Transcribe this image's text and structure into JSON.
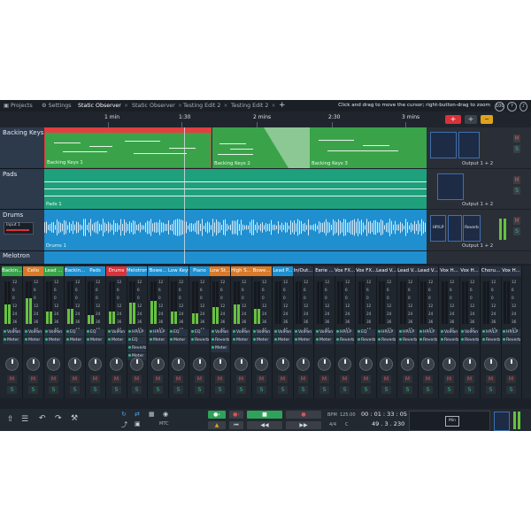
{
  "tabs": [
    {
      "label": "Projects",
      "icon": "folder-icon"
    },
    {
      "label": "Settings",
      "icon": "gear-icon"
    },
    {
      "label": "Static Observer",
      "active": true
    },
    {
      "label": "Static Observer"
    },
    {
      "label": "Testing Edit 2"
    },
    {
      "label": "Testing Edit 2"
    }
  ],
  "hint_text": "Click and drag to move the cursor; right-button-drag to zoom",
  "zoom_value": "100",
  "help_label": "?",
  "ruler": {
    "ticks": [
      "1 min",
      "1:30",
      "2 mins",
      "2:30",
      "3 mins"
    ]
  },
  "toolbar": {
    "add_track_label": "+",
    "add_label": "+",
    "wave_label": "~"
  },
  "tracks": [
    {
      "name": "Backing Keys",
      "clips": [
        "Backing Keys 1",
        "Backing Keys 2",
        "Backing Keys 3"
      ],
      "output": "Output 1 + 2",
      "color": "#3aa34a"
    },
    {
      "name": "Pads",
      "clips": [
        "Pads 1"
      ],
      "output": "Output 1 + 2",
      "color": "#1fa07c"
    },
    {
      "name": "Drums",
      "clips": [
        "Drums 1"
      ],
      "output": "Output 1 + 2",
      "input_label": "Input 1",
      "plugins": [
        "HP/LP",
        "Reverb"
      ],
      "color": "#1f8fd0"
    },
    {
      "name": "Melotron"
    }
  ],
  "mixer": {
    "strips": [
      {
        "name": "Backin...",
        "color": "#3aa34a",
        "plugins": [
          "VolPan",
          "Meter"
        ],
        "level": 0.45
      },
      {
        "name": "Cello",
        "color": "#d87a2a",
        "plugins": [
          "VolPan",
          "Meter"
        ],
        "level": 0.6
      },
      {
        "name": "Lead ...",
        "color": "#3aa34a",
        "plugins": [
          "VolPan",
          "Meter"
        ],
        "level": 0.3
      },
      {
        "name": "Backin...",
        "color": "#1f8fd0",
        "plugins": [
          "EQ",
          "Meter"
        ],
        "level": 0.35
      },
      {
        "name": "Pads",
        "color": "#1f8fd0",
        "plugins": [
          "EQ",
          "Meter"
        ],
        "level": 0.2
      },
      {
        "name": "Drums",
        "color": "#d8323a",
        "plugins": [
          "VolPan",
          "Meter"
        ],
        "level": 0.3
      },
      {
        "name": "Melotron",
        "color": "#1f8fd0",
        "plugins": [
          "HP/LP",
          "EQ",
          "Reverb",
          "Meter"
        ],
        "level": 0.5
      },
      {
        "name": "Bowe...",
        "color": "#1f8fd0",
        "plugins": [
          "HP/LP",
          "Meter"
        ],
        "level": 0.55
      },
      {
        "name": "Low Keys",
        "color": "#1f8fd0",
        "plugins": [
          "EQ",
          "Meter"
        ],
        "level": 0.3
      },
      {
        "name": "Piano",
        "color": "#1f8fd0",
        "plugins": [
          "EQ",
          "Reverb"
        ],
        "level": 0.25
      },
      {
        "name": "Low St...",
        "color": "#d87a2a",
        "plugins": [
          "VolPan",
          "Reverb",
          "Meter"
        ],
        "level": 0.4
      },
      {
        "name": "High S...",
        "color": "#d87a2a",
        "plugins": [
          "VolPan",
          "Meter"
        ],
        "level": 0.45
      },
      {
        "name": "Bowe...",
        "color": "#d87a2a",
        "plugins": [
          "VolPan",
          "Meter"
        ],
        "level": 0.35
      },
      {
        "name": "Lead P...",
        "color": "#1f8fd0",
        "plugins": [
          "VolPan",
          "Meter"
        ],
        "level": 0.0
      },
      {
        "name": "In/Out...",
        "color": "#2a3140",
        "plugins": [
          "VolPan",
          "Meter"
        ],
        "level": 0.0
      },
      {
        "name": "Eerie ...",
        "color": "#2a3140",
        "plugins": [
          "VolPan",
          "Meter"
        ],
        "level": 0.0
      },
      {
        "name": "Vox FX...",
        "color": "#2a3140",
        "plugins": [
          "HP/LP",
          "Reverb"
        ],
        "level": 0.0
      },
      {
        "name": "Vox FX...",
        "color": "#2a3140",
        "plugins": [
          "EQ",
          "Reverb"
        ],
        "level": 0.0
      },
      {
        "name": "Lead V...",
        "color": "#2a3140",
        "plugins": [
          "HP/LP",
          "Reverb"
        ],
        "level": 0.0
      },
      {
        "name": "Lead V...",
        "color": "#2a3140",
        "plugins": [
          "HP/LP",
          "Reverb"
        ],
        "level": 0.0
      },
      {
        "name": "Lead V...",
        "color": "#2a3140",
        "plugins": [
          "HP/LP",
          "Reverb"
        ],
        "level": 0.0
      },
      {
        "name": "Vox H...",
        "color": "#2a3140",
        "plugins": [
          "VolPan",
          "Reverb"
        ],
        "level": 0.0
      },
      {
        "name": "Vox H...",
        "color": "#2a3140",
        "plugins": [
          "VolPan",
          "Reverb"
        ],
        "level": 0.0
      },
      {
        "name": "Choru...",
        "color": "#2a3140",
        "plugins": [
          "HP/LP",
          "Reverb"
        ],
        "level": 0.0
      },
      {
        "name": "Vox H...",
        "color": "#2a3140",
        "plugins": [
          "HP/LP",
          "Reverb"
        ],
        "level": 0.0
      }
    ],
    "scale": [
      "12",
      "6",
      "0",
      "12",
      "24",
      "36",
      "48"
    ],
    "mute_label": "M",
    "solo_label": "S"
  },
  "transport": {
    "mtc_label": "MTC",
    "bpm_label": "BPM",
    "bpm_value": "125.00",
    "time_sig": "4/4",
    "key": "C",
    "time_display": "00 : 01 : 33 : 05",
    "bars_display": "49 . 3 . 230",
    "min_label": "Min"
  }
}
